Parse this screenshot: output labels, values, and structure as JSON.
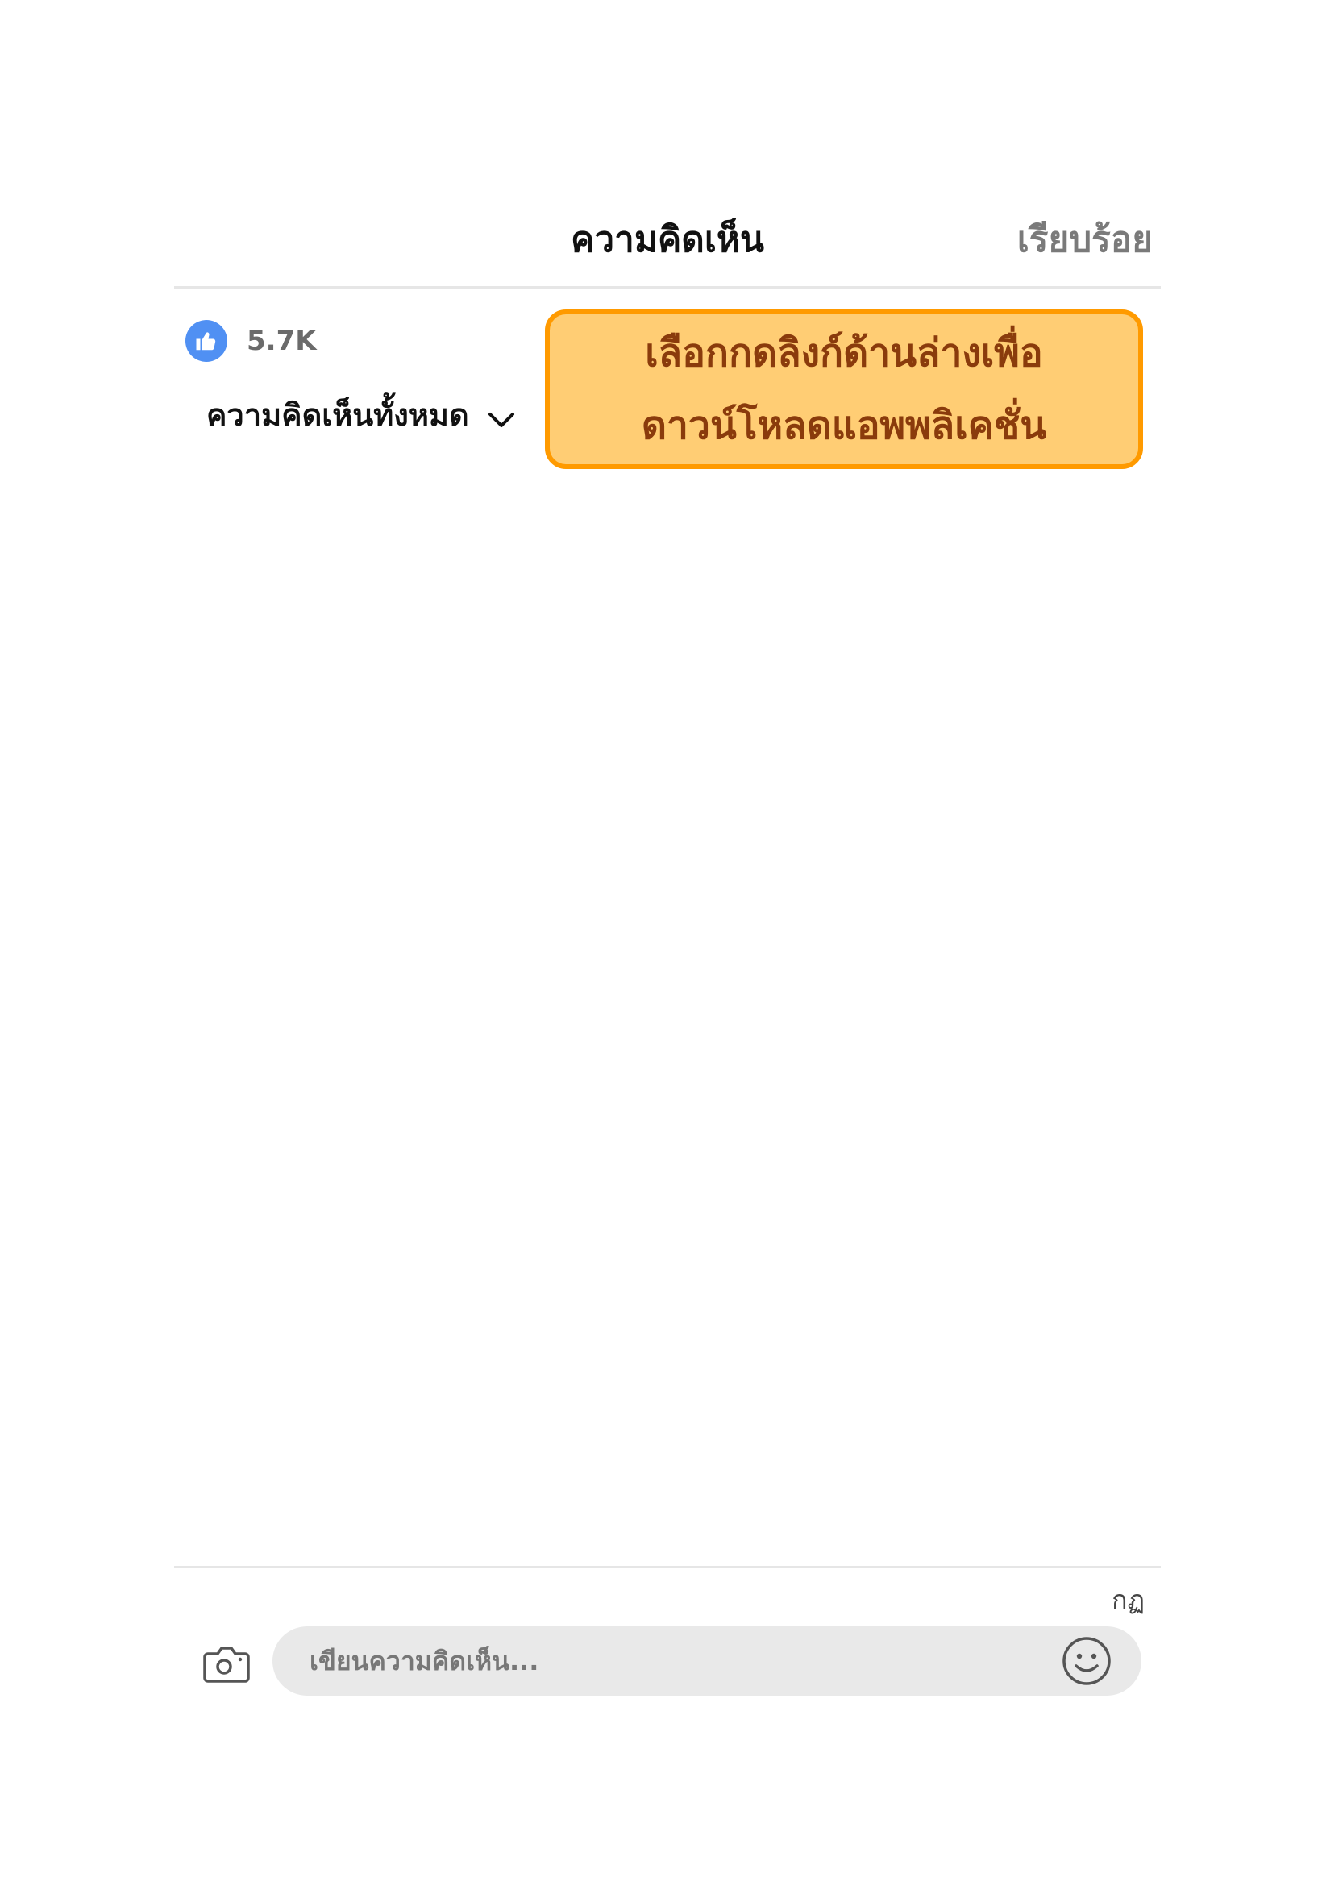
{
  "header": {
    "title": "ความคิดเห็น",
    "done_label": "เรียบร้อย"
  },
  "reactions": {
    "icon": "thumbs-up-icon",
    "count": "5.7K",
    "accent_color": "#5090f3"
  },
  "filter": {
    "label": "ความคิดเห็นทั้งหมด",
    "icon": "chevron-down-icon"
  },
  "callout": {
    "line1": "เลือกกดลิงก์ด้านล่างเพื่อ",
    "line2": "ดาวน์โหลดแอพพลิเคชั่น",
    "fill_color": "#ffcd74",
    "border_color": "#ff9a00",
    "text_color": "#8a3b0c"
  },
  "composer": {
    "keyboard_label": "กฏ",
    "placeholder": "เขียนความคิดเห็น...",
    "camera_icon": "camera-icon",
    "emoji_icon": "smiley-icon"
  }
}
